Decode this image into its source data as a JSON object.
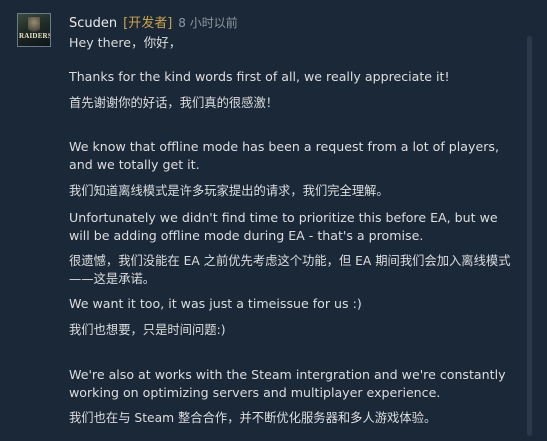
{
  "comment": {
    "author": "Scuden",
    "badge": "[开发者]",
    "time": "8 小时以前",
    "avatar_logo": "RAIDERS",
    "paragraphs": [
      "Hey there，你好，",
      "Thanks for the kind words first of all, we really appreciate it!",
      "首先谢谢你的好话，我们真的很感激！",
      "We know that offline mode has been a request from a lot of players, and we totally get it.",
      "我们知道离线模式是许多玩家提出的请求，我们完全理解。",
      "Unfortunately we didn't find time to prioritize this before EA, but we will be adding offline mode during EA - that's a promise.",
      "很遗憾，我们没能在 EA 之前优先考虑这个功能，但 EA 期间我们会加入离线模式——这是承诺。",
      "We want it too, it was just a timeissue for us :)",
      "我们也想要，只是时间问题:)",
      "We're also at works with the Steam intergration and we're constantly working on optimizing servers and multiplayer experience.",
      "我们也在与 Steam 整合合作，并不断优化服务器和多人游戏体验。"
    ]
  },
  "colors": {
    "background": "#1b2838",
    "text": "#dcdedf",
    "developer_badge": "#c9a24a",
    "timestamp": "#8f98a0"
  }
}
